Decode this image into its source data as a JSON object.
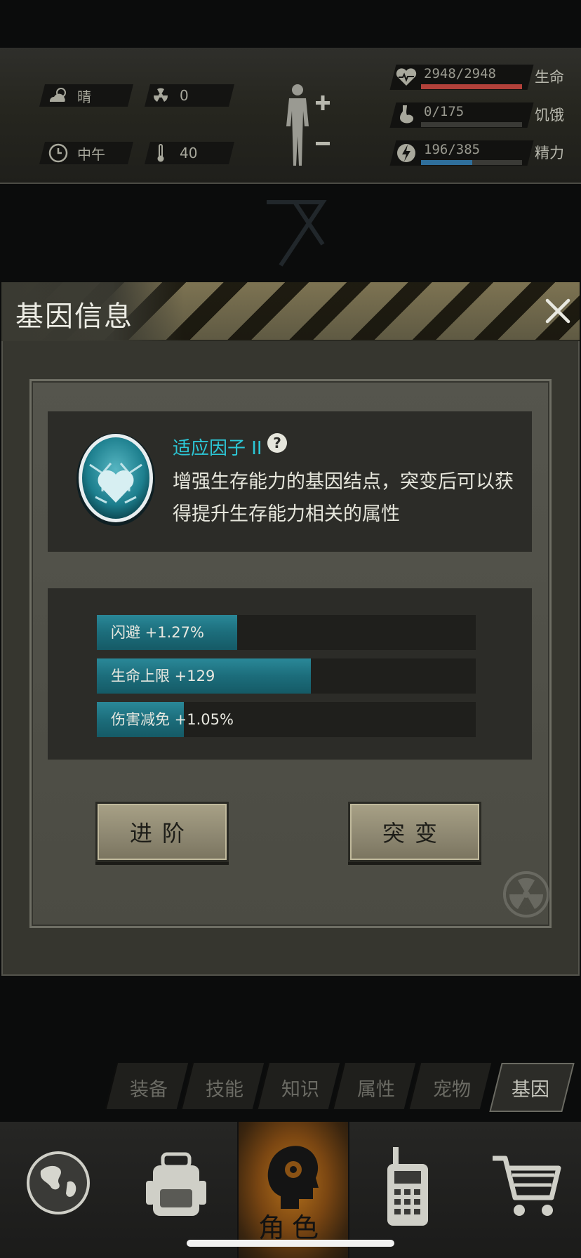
{
  "hud": {
    "weather": {
      "icon": "partly-cloudy-icon",
      "value": "晴"
    },
    "radiation": {
      "icon": "radiation-icon",
      "value": "0"
    },
    "time": {
      "icon": "clock-icon",
      "value": "中午"
    },
    "temperature": {
      "icon": "thermometer-icon",
      "value": "40"
    },
    "stats": [
      {
        "icon": "heart-icon",
        "value": "2948/2948",
        "label": "生命",
        "fraction": 1.0,
        "color": "#b2413a"
      },
      {
        "icon": "stomach-icon",
        "value": "0/175",
        "label": "饥饿",
        "fraction": 0.0,
        "color": "#8a8a80"
      },
      {
        "icon": "energy-icon",
        "value": "196/385",
        "label": "精力",
        "fraction": 0.509,
        "color": "#2f6f9c"
      }
    ]
  },
  "dialog": {
    "title": "基因信息",
    "gene_name": "适应因子 II",
    "description": "增强生存能力的基因结点，突变后可以获得提升生存能力相关的属性",
    "bonuses": [
      {
        "label": "闪避 +1.27%",
        "fraction": 0.37
      },
      {
        "label": "生命上限 +129",
        "fraction": 0.565
      },
      {
        "label": "伤害减免 +1.05%",
        "fraction": 0.23
      }
    ],
    "advance_label": "进阶",
    "mutate_label": "突变"
  },
  "tabs": [
    {
      "label": "装备",
      "active": false
    },
    {
      "label": "技能",
      "active": false
    },
    {
      "label": "知识",
      "active": false
    },
    {
      "label": "属性",
      "active": false
    },
    {
      "label": "宠物",
      "active": false
    },
    {
      "label": "基因",
      "active": true
    }
  ],
  "nav": {
    "items": [
      "globe-icon",
      "backpack-icon",
      "character-icon",
      "radio-icon",
      "shop-cart-icon"
    ],
    "active_label": "角色"
  },
  "colors": {
    "accent": "#2cc7d6",
    "bar_fill": "#1c6d7b",
    "nav_active": "#b5711a"
  }
}
